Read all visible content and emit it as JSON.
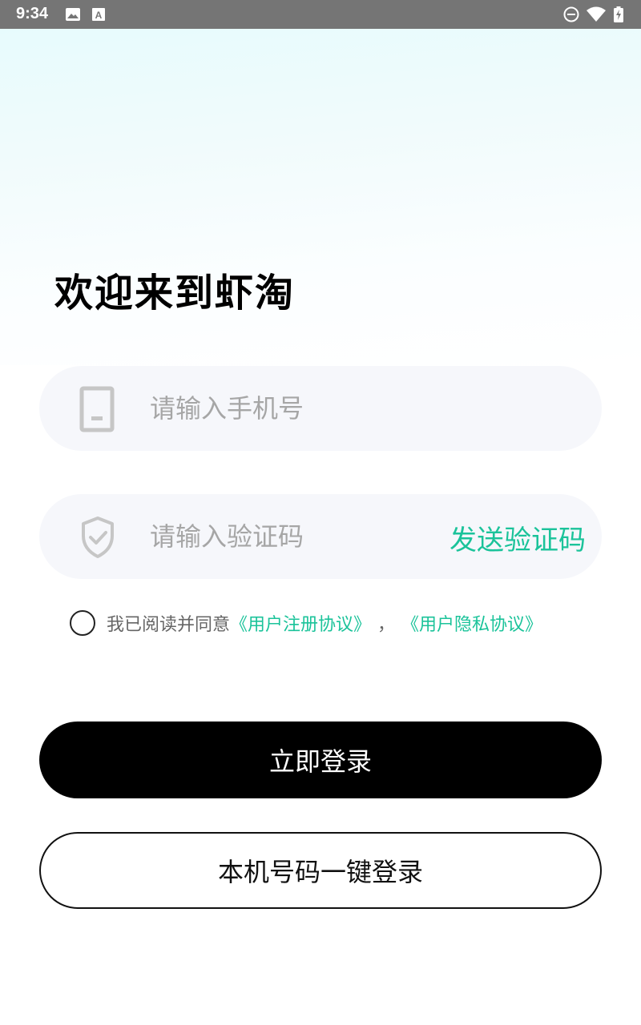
{
  "status_bar": {
    "time": "9:34",
    "left_icons": [
      "image-icon",
      "text-a-icon"
    ],
    "right_icons": [
      "do-not-disturb-icon",
      "wifi-icon",
      "battery-charging-icon"
    ]
  },
  "welcome_title": "欢迎来到虾淘",
  "phone_field": {
    "placeholder": "请输入手机号",
    "value": "",
    "icon": "phone-icon"
  },
  "code_field": {
    "placeholder": "请输入验证码",
    "value": "",
    "icon": "shield-check-icon",
    "send_label": "发送验证码"
  },
  "agreement": {
    "checked": false,
    "prefix": "我已阅读并同意",
    "user_agreement": "《用户注册协议》",
    "separator": "，",
    "privacy_policy": "《用户隐私协议》"
  },
  "login_button": "立即登录",
  "one_click_button": "本机号码一键登录",
  "colors": {
    "accent": "#1bc39a",
    "primary_button": "#000000",
    "field_background": "#f6f7fb",
    "status_bar": "#757575"
  }
}
